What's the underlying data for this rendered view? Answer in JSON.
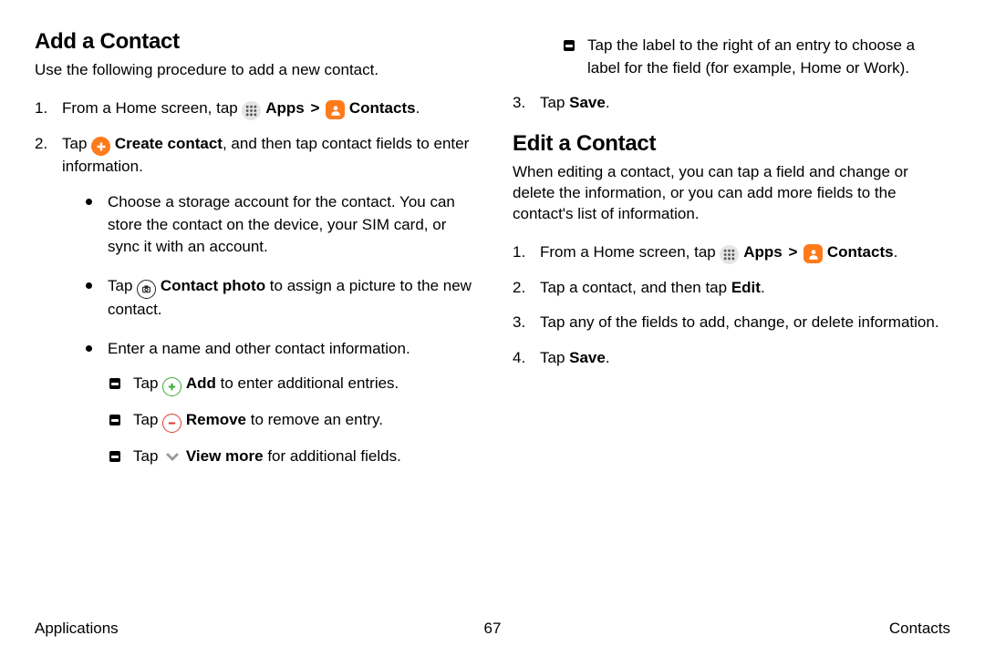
{
  "left": {
    "heading": "Add a Contact",
    "intro": "Use the following procedure to add a new contact.",
    "step1_a": "From a Home screen, tap ",
    "apps": "Apps",
    "sep": ">",
    "contacts": "Contacts",
    "period": ".",
    "step2_a": "Tap ",
    "create_contact": "Create contact",
    "step2_b": ", and then tap contact fields to enter information.",
    "b1": "Choose a storage account for the contact. You can store the contact on the device, your SIM card, or sync it with an account.",
    "b2_a": "Tap ",
    "contact_photo": "Contact photo",
    "b2_b": " to assign a picture to the new contact.",
    "b3": "Enter a name and other contact information.",
    "d1_a": "Tap ",
    "add": "Add",
    "d1_b": " to enter additional entries.",
    "d2_a": "Tap ",
    "remove": "Remove",
    "d2_b": " to remove an entry.",
    "d3_a": "Tap ",
    "view_more": "View more",
    "d3_b": " for additional fields."
  },
  "right": {
    "d1": "Tap the label to the right of an entry to choose a label for the field (for example, Home or Work).",
    "step3_a": "Tap ",
    "save": "Save",
    "period": ".",
    "heading2": "Edit a Contact",
    "intro2": "When editing a contact, you can tap a field and change or delete the information, or you can add more fields to the contact's list of information.",
    "e1_a": "From a Home screen, tap ",
    "apps": "Apps",
    "sep": ">",
    "contacts": "Contacts",
    "e2_a": "Tap a contact, and then tap ",
    "edit": "Edit",
    "e3": "Tap any of the fields to add, change, or delete information.",
    "e4_a": "Tap ",
    "e4_save": "Save"
  },
  "footer": {
    "left": "Applications",
    "center": "67",
    "right": "Contacts"
  }
}
